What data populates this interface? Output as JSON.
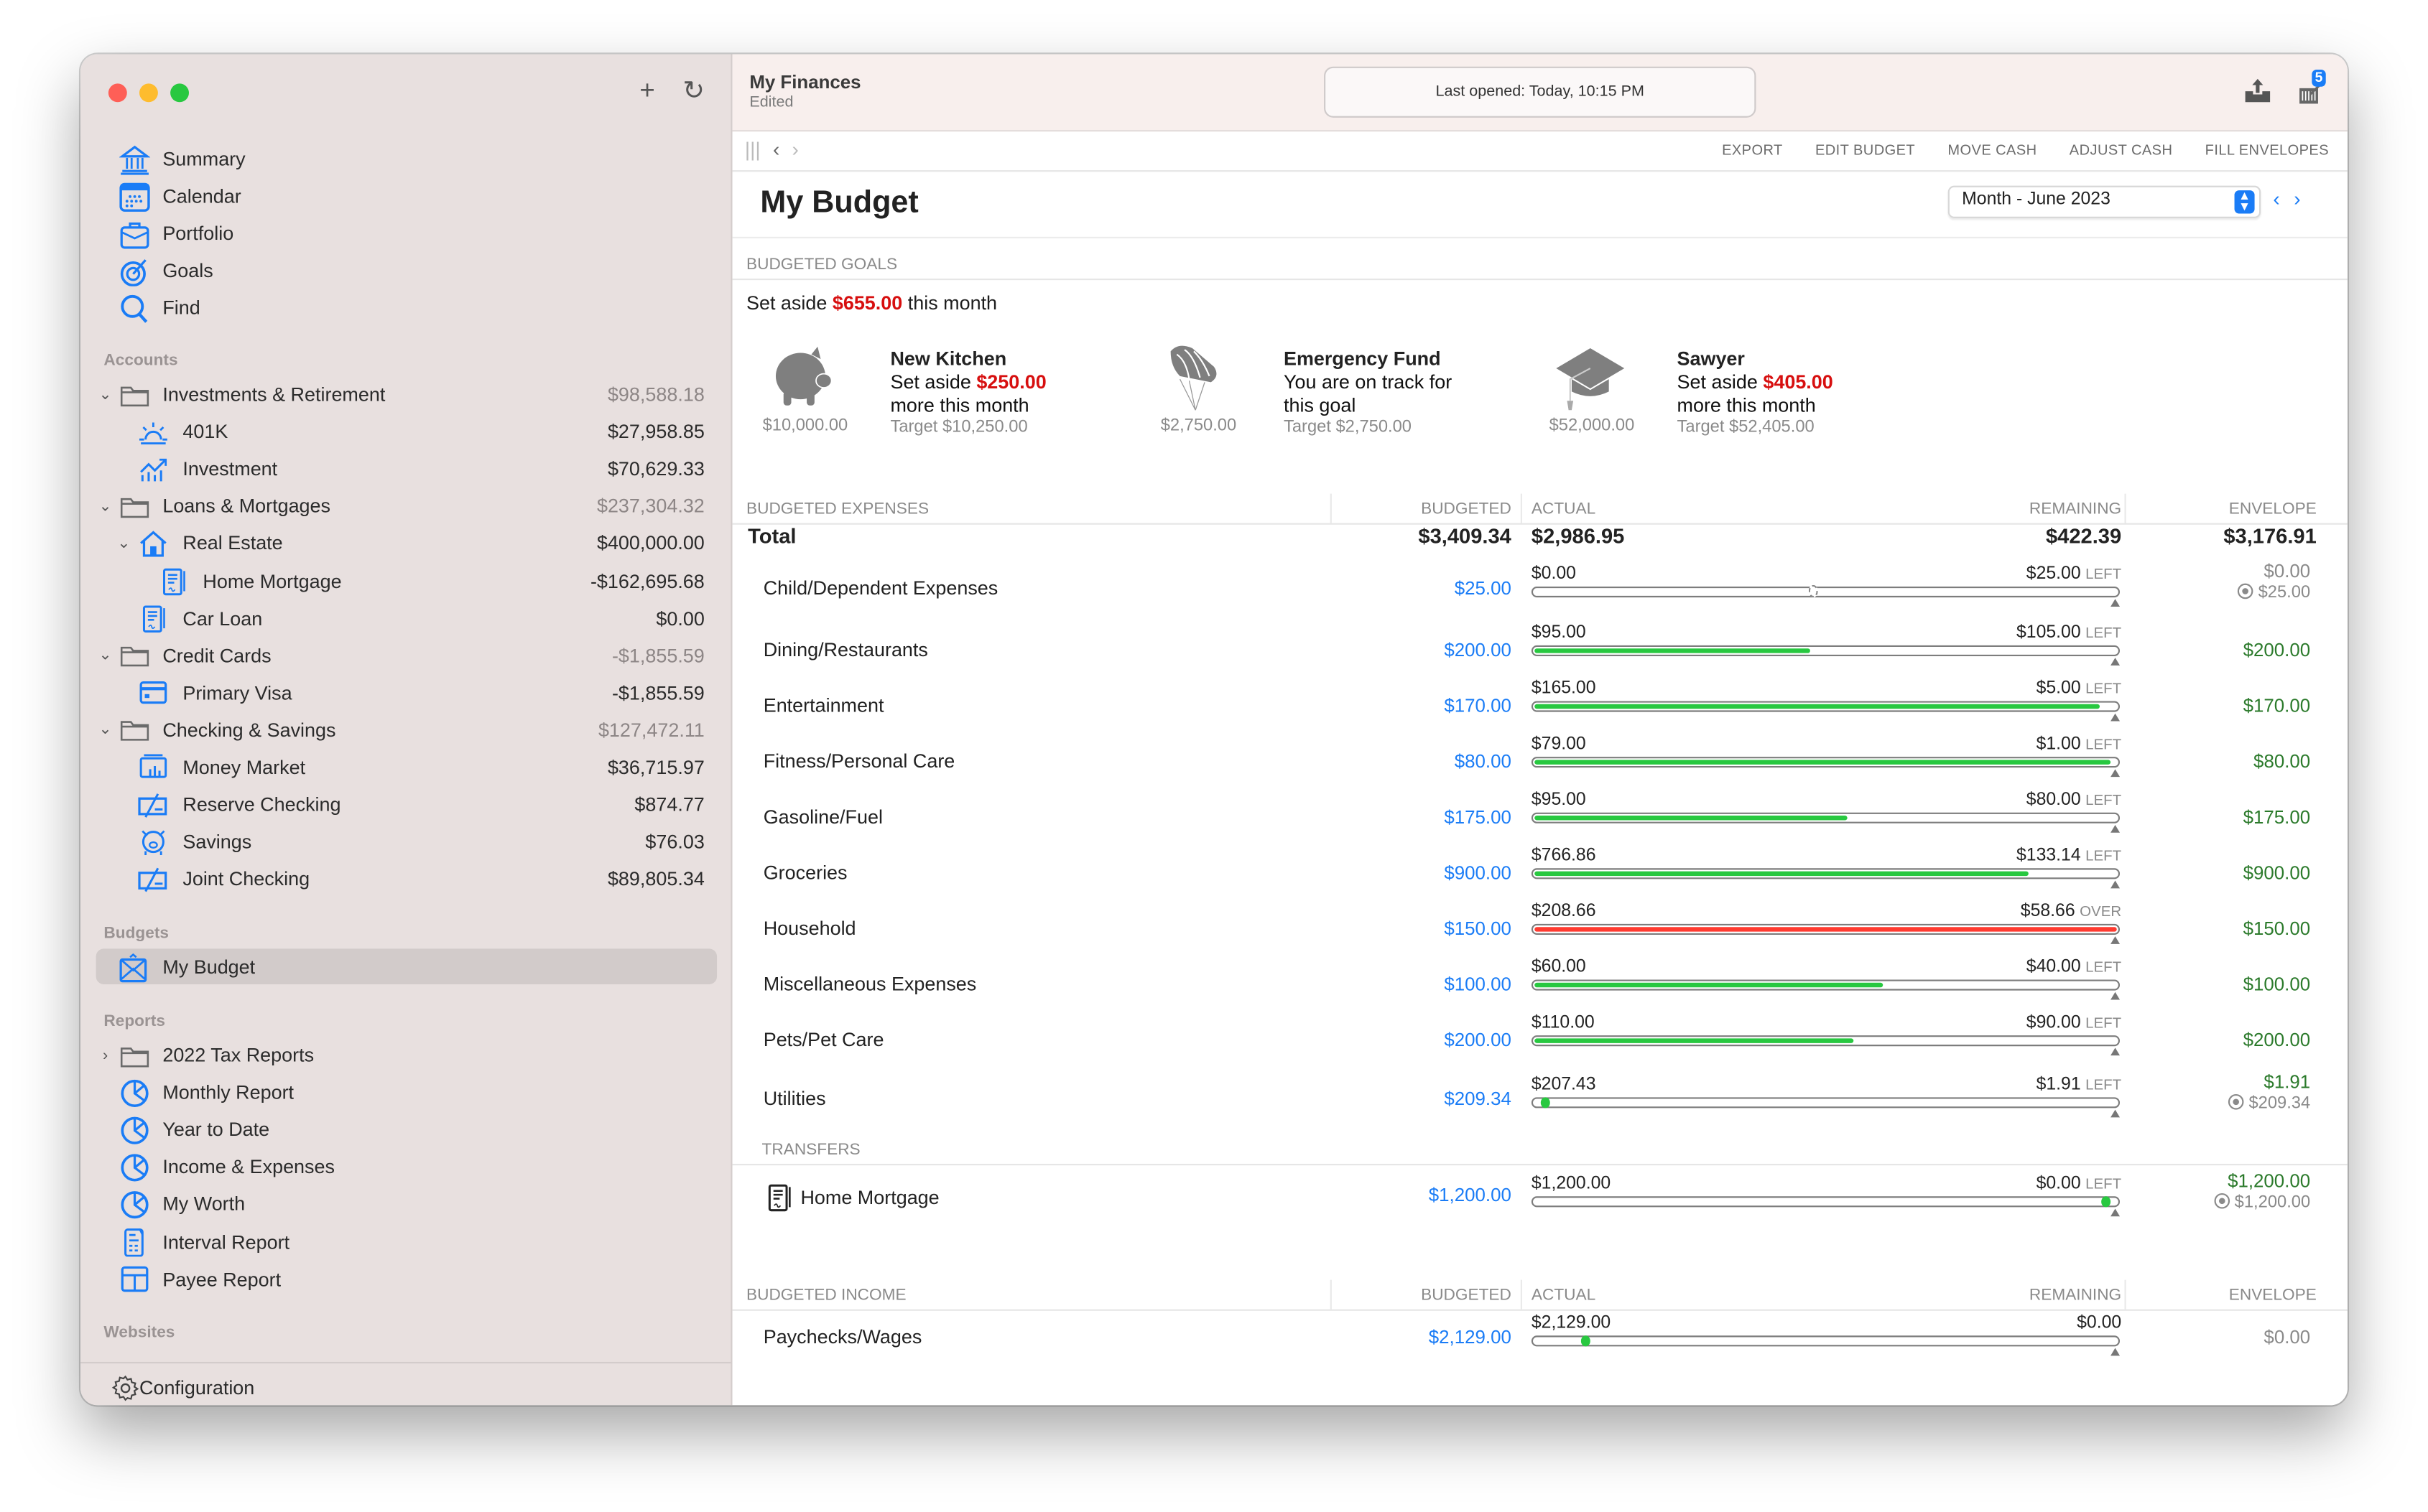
{
  "window": {
    "traffic_lights": [
      "close",
      "minimize",
      "zoom"
    ]
  },
  "sidebar": {
    "top_buttons": [
      {
        "icon": "plus-icon",
        "glyph": "+"
      },
      {
        "icon": "refresh-icon",
        "glyph": "↻"
      }
    ],
    "nav": [
      {
        "label": "Summary",
        "icon": "bank-icon"
      },
      {
        "label": "Calendar",
        "icon": "calendar-icon"
      },
      {
        "label": "Portfolio",
        "icon": "briefcase-icon"
      },
      {
        "label": "Goals",
        "icon": "target-icon"
      },
      {
        "label": "Find",
        "icon": "search-icon"
      }
    ],
    "accounts_label": "Accounts",
    "accounts": [
      {
        "label": "Investments & Retirement",
        "amount": "$98,588.18",
        "level": 0,
        "group": true,
        "expanded": true,
        "icon": "folder-icon"
      },
      {
        "label": "401K",
        "amount": "$27,958.85",
        "level": 1,
        "icon": "sunrise-icon"
      },
      {
        "label": "Investment",
        "amount": "$70,629.33",
        "level": 1,
        "icon": "chart-up-icon"
      },
      {
        "label": "Loans & Mortgages",
        "amount": "$237,304.32",
        "level": 0,
        "group": true,
        "expanded": true,
        "icon": "folder-icon"
      },
      {
        "label": "Real Estate",
        "amount": "$400,000.00",
        "level": 1,
        "expanded": true,
        "icon": "house-icon"
      },
      {
        "label": "Home Mortgage",
        "amount": "-$162,695.68",
        "level": 2,
        "icon": "contract-icon"
      },
      {
        "label": "Car Loan",
        "amount": "$0.00",
        "level": 1,
        "icon": "contract-icon"
      },
      {
        "label": "Credit Cards",
        "amount": "-$1,855.59",
        "level": 0,
        "group": true,
        "expanded": true,
        "icon": "folder-icon"
      },
      {
        "label": "Primary Visa",
        "amount": "-$1,855.59",
        "level": 1,
        "icon": "credit-card-icon"
      },
      {
        "label": "Checking & Savings",
        "amount": "$127,472.11",
        "level": 0,
        "group": true,
        "expanded": true,
        "icon": "folder-icon"
      },
      {
        "label": "Money Market",
        "amount": "$36,715.97",
        "level": 1,
        "icon": "money-market-icon"
      },
      {
        "label": "Reserve Checking",
        "amount": "$874.77",
        "level": 1,
        "icon": "checkbook-icon"
      },
      {
        "label": "Savings",
        "amount": "$76.03",
        "level": 1,
        "icon": "piggy-bank-icon"
      },
      {
        "label": "Joint Checking",
        "amount": "$89,805.34",
        "level": 1,
        "icon": "checkbook-icon"
      }
    ],
    "budgets_label": "Budgets",
    "budgets": [
      {
        "label": "My Budget",
        "icon": "envelope-icon",
        "selected": true
      }
    ],
    "reports_label": "Reports",
    "reports": [
      {
        "label": "2022 Tax Reports",
        "icon": "folder-icon",
        "collapsed": true
      },
      {
        "label": "Monthly Report",
        "icon": "pie-chart-icon"
      },
      {
        "label": "Year to Date",
        "icon": "pie-chart-icon"
      },
      {
        "label": "Income & Expenses",
        "icon": "pie-chart-icon"
      },
      {
        "label": "My Worth",
        "icon": "pie-chart-icon"
      },
      {
        "label": "Interval Report",
        "icon": "clipboard-report-icon"
      },
      {
        "label": "Payee Report",
        "icon": "table-icon"
      }
    ],
    "websites_label": "Websites",
    "configuration_label": "Configuration"
  },
  "titlebar": {
    "doc_title": "My Finances",
    "doc_status": "Edited",
    "status_text": "Last opened: Today, 10:15 PM",
    "notification_count": "5"
  },
  "toolbar": {
    "actions": [
      "EXPORT",
      "EDIT BUDGET",
      "MOVE CASH",
      "ADJUST CASH",
      "FILL ENVELOPES"
    ]
  },
  "page": {
    "title": "My Budget",
    "period": "Month - June 2023"
  },
  "goals": {
    "header": "BUDGETED GOALS",
    "summary_prefix": "Set aside ",
    "summary_amount": "$655.00",
    "summary_suffix": " this month",
    "items": [
      {
        "name": "New Kitchen",
        "icon": "piggy-bank-icon",
        "saved": "$10,000.00",
        "line1_prefix": "Set aside ",
        "line1_amount": "$250.00",
        "line1_suffix": "",
        "line2": "more this month",
        "target": "Target $10,250.00"
      },
      {
        "name": "Emergency Fund",
        "icon": "parachute-icon",
        "saved": "$2,750.00",
        "line1_prefix": "You are on track for",
        "line1_amount": "",
        "line1_suffix": "",
        "line2": "this goal",
        "target": "Target $2,750.00"
      },
      {
        "name": "Sawyer",
        "icon": "graduation-cap-icon",
        "saved": "$52,000.00",
        "line1_prefix": "Set aside ",
        "line1_amount": "$405.00",
        "line1_suffix": "",
        "line2": "more this month",
        "target": "Target $52,405.00"
      }
    ]
  },
  "expenses": {
    "header": {
      "title": "BUDGETED EXPENSES",
      "budgeted": "BUDGETED",
      "actual": "ACTUAL",
      "remaining": "REMAINING",
      "envelope": "ENVELOPE"
    },
    "total": {
      "label": "Total",
      "budgeted": "$3,409.34",
      "actual": "$2,986.95",
      "remaining": "$422.39",
      "envelope": "$3,176.91"
    },
    "rows": [
      {
        "name": "Child/Dependent Expenses",
        "budgeted": "$25.00",
        "actual": "$0.00",
        "remaining": "$25.00",
        "status": "LEFT",
        "progress": 0,
        "bar": "ghost",
        "envelope": "$0.00",
        "envelope_style": "grey",
        "envelope_target": "$25.00"
      },
      {
        "name": "Dining/Restaurants",
        "budgeted": "$200.00",
        "actual": "$95.00",
        "remaining": "$105.00",
        "status": "LEFT",
        "progress": 0.475,
        "bar": "green",
        "envelope": "$200.00",
        "envelope_style": "green"
      },
      {
        "name": "Entertainment",
        "budgeted": "$170.00",
        "actual": "$165.00",
        "remaining": "$5.00",
        "status": "LEFT",
        "progress": 0.97,
        "bar": "green",
        "envelope": "$170.00",
        "envelope_style": "green"
      },
      {
        "name": "Fitness/Personal Care",
        "budgeted": "$80.00",
        "actual": "$79.00",
        "remaining": "$1.00",
        "status": "LEFT",
        "progress": 0.99,
        "bar": "green",
        "envelope": "$80.00",
        "envelope_style": "green"
      },
      {
        "name": "Gasoline/Fuel",
        "budgeted": "$175.00",
        "actual": "$95.00",
        "remaining": "$80.00",
        "status": "LEFT",
        "progress": 0.54,
        "bar": "green",
        "envelope": "$175.00",
        "envelope_style": "green"
      },
      {
        "name": "Groceries",
        "budgeted": "$900.00",
        "actual": "$766.86",
        "remaining": "$133.14",
        "status": "LEFT",
        "progress": 0.85,
        "bar": "green",
        "envelope": "$900.00",
        "envelope_style": "green"
      },
      {
        "name": "Household",
        "budgeted": "$150.00",
        "actual": "$208.66",
        "remaining": "$58.66",
        "status": "OVER",
        "progress": 1,
        "bar": "red",
        "envelope": "$150.00",
        "envelope_style": "green"
      },
      {
        "name": "Miscellaneous Expenses",
        "budgeted": "$100.00",
        "actual": "$60.00",
        "remaining": "$40.00",
        "status": "LEFT",
        "progress": 0.6,
        "bar": "green",
        "envelope": "$100.00",
        "envelope_style": "green"
      },
      {
        "name": "Pets/Pet Care",
        "budgeted": "$200.00",
        "actual": "$110.00",
        "remaining": "$90.00",
        "status": "LEFT",
        "progress": 0.55,
        "bar": "green",
        "envelope": "$200.00",
        "envelope_style": "green"
      },
      {
        "name": "Utilities",
        "budgeted": "$209.34",
        "actual": "$207.43",
        "remaining": "$1.91",
        "status": "LEFT",
        "progress": 0.02,
        "bar": "dot",
        "envelope": "$1.91",
        "envelope_style": "green",
        "envelope_target": "$209.34"
      }
    ]
  },
  "transfers": {
    "header": "TRANSFERS",
    "rows": [
      {
        "name": "Home Mortgage",
        "icon": "contract-icon",
        "budgeted": "$1,200.00",
        "actual": "$1,200.00",
        "remaining": "$0.00",
        "status": "LEFT",
        "progress": 0.98,
        "bar": "dot",
        "envelope": "$1,200.00",
        "envelope_style": "green",
        "envelope_target": "$1,200.00"
      }
    ]
  },
  "income": {
    "header": {
      "title": "BUDGETED INCOME",
      "budgeted": "BUDGETED",
      "actual": "ACTUAL",
      "remaining": "REMAINING",
      "envelope": "ENVELOPE"
    },
    "rows": [
      {
        "name": "Paychecks/Wages",
        "budgeted": "$2,129.00",
        "actual": "$2,129.00",
        "remaining": "$0.00",
        "status": "",
        "progress": 0.09,
        "bar": "dot",
        "envelope": "$0.00",
        "envelope_style": "grey"
      }
    ]
  },
  "colors": {
    "accent": "#1a7cf6",
    "over": "#ff3b30",
    "ok": "#28c840",
    "envelope_green": "#2b7a2b",
    "alert_red": "#d70f0f",
    "sidebar_bg": "#e8e0df",
    "titlebar_bg": "#f8efed"
  }
}
